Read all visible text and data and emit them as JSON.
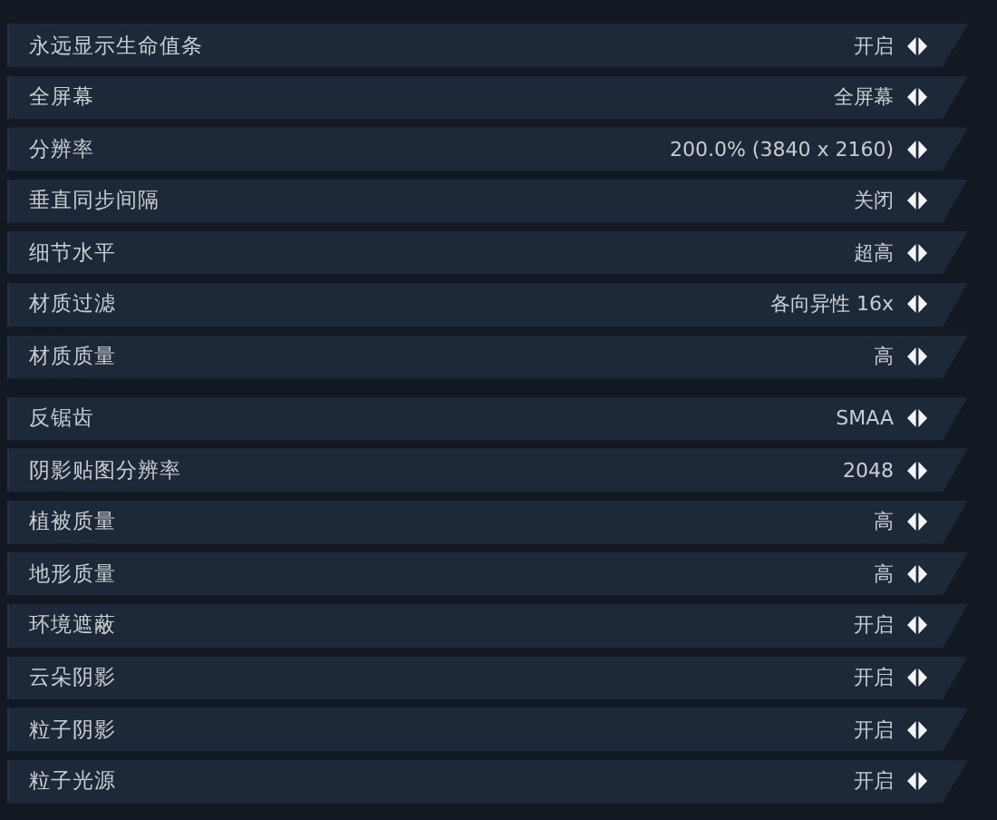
{
  "groups": [
    {
      "rows": [
        {
          "label": "永远显示生命值条",
          "value": "开启"
        },
        {
          "label": "全屏幕",
          "value": "全屏幕"
        },
        {
          "label": "分辨率",
          "value": "200.0% (3840 x 2160)"
        },
        {
          "label": "垂直同步间隔",
          "value": "关闭"
        },
        {
          "label": "细节水平",
          "value": "超高"
        },
        {
          "label": "材质过滤",
          "value": "各向异性 16x"
        },
        {
          "label": "材质质量",
          "value": "高"
        }
      ]
    },
    {
      "rows": [
        {
          "label": "反锯齿",
          "value": "SMAA"
        },
        {
          "label": "阴影贴图分辨率",
          "value": "2048"
        },
        {
          "label": "植被质量",
          "value": "高"
        },
        {
          "label": "地形质量",
          "value": "高"
        },
        {
          "label": "环境遮蔽",
          "value": "开启"
        },
        {
          "label": "云朵阴影",
          "value": "开启"
        },
        {
          "label": "粒子阴影",
          "value": "开启"
        },
        {
          "label": "粒子光源",
          "value": "开启"
        }
      ]
    }
  ]
}
